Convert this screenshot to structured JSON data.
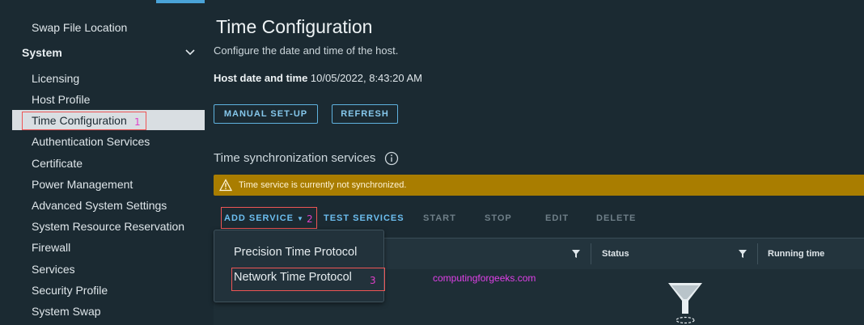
{
  "sidebar": {
    "items_top": [
      {
        "label": "Swap File Location"
      }
    ],
    "section": {
      "label": "System",
      "icon": "chevron-down-icon"
    },
    "items": [
      {
        "label": "Licensing"
      },
      {
        "label": "Host Profile"
      },
      {
        "label": "Time Configuration",
        "selected": true
      },
      {
        "label": "Authentication Services"
      },
      {
        "label": "Certificate"
      },
      {
        "label": "Power Management"
      },
      {
        "label": "Advanced System Settings"
      },
      {
        "label": "System Resource Reservation"
      },
      {
        "label": "Firewall"
      },
      {
        "label": "Services"
      },
      {
        "label": "Security Profile"
      },
      {
        "label": "System Swap"
      }
    ]
  },
  "annotations": {
    "n1": "1",
    "n2": "2",
    "n3": "3"
  },
  "main": {
    "title": "Time Configuration",
    "subtitle": "Configure the date and time of the host.",
    "host_date_label": "Host date and time",
    "host_date_value": "10/05/2022, 8:43:20 AM",
    "buttons": {
      "manual": "MANUAL SET-UP",
      "refresh": "REFRESH"
    },
    "sync_title": "Time synchronization services",
    "banner": "Time service is currently not synchronized.",
    "toolbar": {
      "add_service": "ADD SERVICE",
      "test_services": "TEST SERVICES",
      "start": "START",
      "stop": "STOP",
      "edit": "EDIT",
      "delete": "DELETE"
    },
    "table": {
      "columns": [
        "Status",
        "Running time"
      ]
    },
    "dropdown": [
      "Precision Time Protocol",
      "Network Time Protocol"
    ]
  },
  "watermark": "computingforgeeks.com",
  "colors": {
    "accent": "#4aa3d8",
    "warning": "#a97d00",
    "background": "#1b2a32",
    "annotation": "#e040c8"
  }
}
